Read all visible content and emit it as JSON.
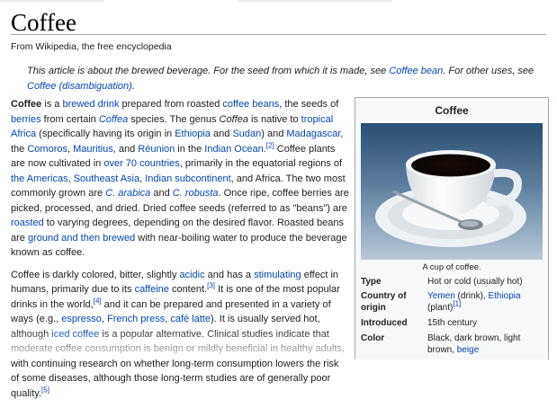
{
  "page": {
    "title": "Coffee",
    "tagline": "From Wikipedia, the free encyclopedia"
  },
  "hatnote": {
    "t1": "This article is about the brewed beverage. For the seed from which it is made, see ",
    "link1": "Coffee bean",
    "t2": ". For other uses, see ",
    "link2": "Coffee (disambiguation)",
    "t3": "."
  },
  "para1": {
    "s1": "Coffee",
    "s2": " is a ",
    "l1": "brewed drink",
    "s3": " prepared from roasted ",
    "l2": "coffee beans",
    "s4": ", the seeds of ",
    "l3": "berries",
    "s5": " from certain ",
    "l4": "Coffea",
    "s6": " species. The genus ",
    "s7": "Coffea",
    "s8": " is native to ",
    "l5": "tropical Africa",
    "s9": " (specifically having its origin in ",
    "l6": "Ethiopia",
    "s10": " and ",
    "l7": "Sudan",
    "s11": ") and ",
    "l8": "Madagascar",
    "s12": ", the ",
    "l9": "Comoros",
    "s13": ", ",
    "l10": "Mauritius",
    "s14": ", and ",
    "l11": "Réunion",
    "s15": " in the ",
    "l12": "Indian Ocean",
    "s16": ".",
    "ref": "[2]",
    "s17": " Coffee plants are now cultivated in ",
    "l13": "over 70 countries",
    "s18": ", primarily in the equatorial regions of ",
    "l14": "the Americas",
    "s19": ", ",
    "l15": "Southeast Asia",
    "s20": ", ",
    "l16": "Indian subcontinent",
    "s21": ", and Africa. The two most commonly grown are ",
    "l17": "C. arabica",
    "s22": " and ",
    "l18": "C. robusta",
    "s23": ". Once ripe, coffee berries are picked, processed, and dried. Dried coffee seeds (referred to as \"beans\") are ",
    "l19": "roasted",
    "s24": " to varying degrees, depending on the desired flavor. Roasted beans are ",
    "l20": "ground and then brewed",
    "s25": " with near-boiling water to produce the beverage known as coffee."
  },
  "para2": {
    "s1": "Coffee is darkly colored, bitter, slightly ",
    "l1": "acidic",
    "s2": " and has a ",
    "l2": "stimulating",
    "s3": " effect in humans, primarily due to its ",
    "l3": "caffeine",
    "s4": " content.",
    "ref1": "[3]",
    "s5": " It is one of the most popular drinks in the world,",
    "ref2": "[4]",
    "s6": " and it can be prepared and presented in a variety of ways (e.g., ",
    "l4": "espresso",
    "s7": ", ",
    "l5": "French press",
    "s8": ", ",
    "l6": "café latte",
    "s9": "). It is usually served hot, although ",
    "l7": "iced coffee",
    "s10": " is a popular alternative. Clinical studies indicate that moderate coffee consumption is benign or mildly beneficial in healthy adults, with continuing research on whether long-term consumption lowers the risk of some diseases, although those long-term studies are of generally poor quality.",
    "ref3": "[5]"
  },
  "infobox": {
    "title": "Coffee",
    "caption": "A cup of coffee.",
    "rows": [
      {
        "key": "Type",
        "value": "Hot or cold (usually hot)"
      },
      {
        "key": "Country of origin",
        "link1": "Yemen",
        "t1": " (drink), ",
        "link2": "Ethiopia",
        "t2": " (plant)",
        "ref": "[1]"
      },
      {
        "key": "Introduced",
        "value": "15th century"
      },
      {
        "key": "Color",
        "value": "Black, dark brown, light brown, ",
        "link": "beige"
      }
    ]
  }
}
